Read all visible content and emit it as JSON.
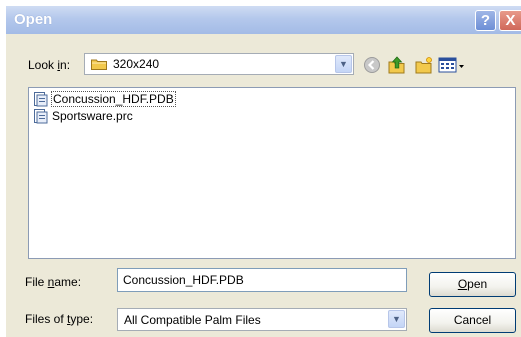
{
  "window": {
    "title": "Open"
  },
  "titlebar": {
    "help_label": "?",
    "close_label": "X"
  },
  "lookin": {
    "label_prefix": "Look ",
    "label_access": "i",
    "label_suffix": "n:",
    "value": "320x240"
  },
  "toolbar": {
    "icons": [
      "back-icon",
      "up-folder-icon",
      "new-folder-icon",
      "view-menu-icon"
    ]
  },
  "files": [
    {
      "name": "Concussion_HDF.PDB",
      "selected": true
    },
    {
      "name": "Sportsware.prc",
      "selected": false
    }
  ],
  "filename": {
    "label_prefix": "File ",
    "label_access": "n",
    "label_suffix": "ame:",
    "value": "Concussion_HDF.PDB"
  },
  "filetype": {
    "label_prefix": "Files of ",
    "label_access": "t",
    "label_suffix": "ype:",
    "value": "All Compatible Palm Files"
  },
  "buttons": {
    "open_access": "O",
    "open_rest": "pen",
    "cancel": "Cancel"
  },
  "colors": {
    "titlebar": "#a3bbe6",
    "dialog_bg": "#ece9d8",
    "up_arrow": "#3f9a2a",
    "folder": "#f2c94c"
  }
}
